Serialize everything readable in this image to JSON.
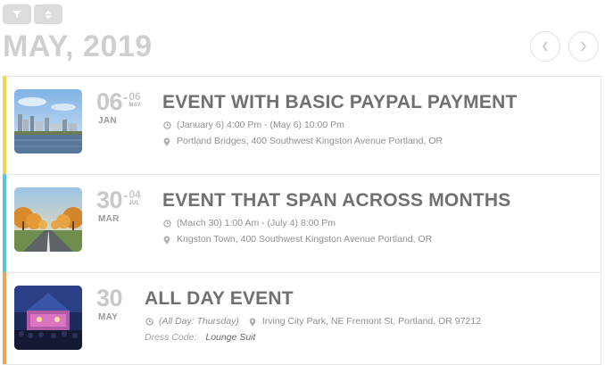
{
  "header": {
    "month_title": "MAY, 2019",
    "filter_icon": "filter-icon",
    "sort_icon": "sort-icon",
    "prev_icon": "chevron-left-icon",
    "next_icon": "chevron-right-icon"
  },
  "colors": {
    "accent_1": "#f1d651",
    "accent_2": "#57c3de",
    "accent_3": "#f0a45a"
  },
  "events": [
    {
      "day": "06",
      "month": "JAN",
      "end_day": "06",
      "end_month": "MAY",
      "title": "EVENT WITH BASIC PAYPAL PAYMENT",
      "time": "(January 6) 4:00 Pm - (May 6) 10:00 Pm",
      "location": "Portland Bridges, 400 Southwest Kingston Avenue Portland, OR"
    },
    {
      "day": "30",
      "month": "MAR",
      "end_day": "04",
      "end_month": "JUL",
      "title": "EVENT THAT SPAN ACROSS MONTHS",
      "time": "(March 30) 1:00 Am - (July 4) 8:00 Pm",
      "location": "Kngston Town, 400 Southwest Kingston Avenue Portland, OR"
    },
    {
      "day": "30",
      "month": "MAY",
      "title": "ALL DAY EVENT",
      "time": "(All Day: Thursday)",
      "location": "Irving City Park, NE Fremont St, Portland, OR 97212",
      "dress_label": "Dress Code:",
      "dress_value": "Lounge Suit"
    }
  ]
}
